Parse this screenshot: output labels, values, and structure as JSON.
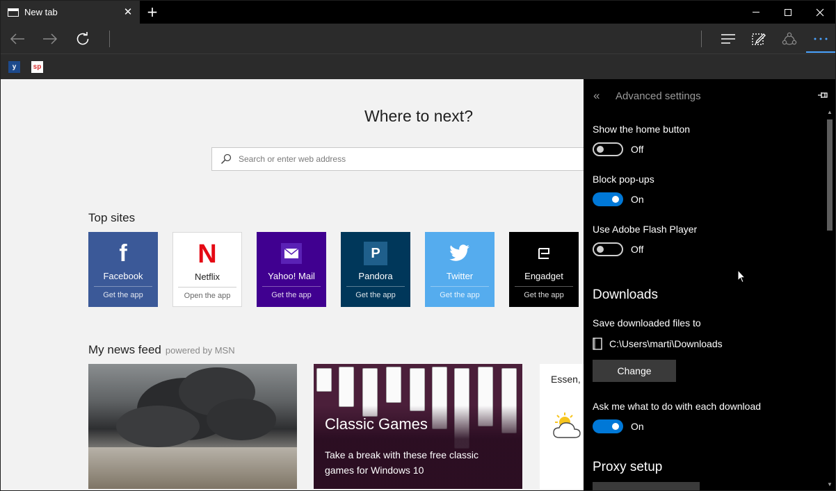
{
  "browser": {
    "tab_title": "New tab",
    "tab_close": "✕",
    "new_tab": "+"
  },
  "favorites": [
    {
      "label": "y"
    },
    {
      "label": "sp"
    }
  ],
  "newtab": {
    "heading": "Where to next?",
    "search_placeholder": "Search or enter web address",
    "top_sites_title": "Top sites",
    "top_sites": [
      {
        "name": "Facebook",
        "action": "Get the app",
        "bg": "#3b5998",
        "fg": "#ffffff"
      },
      {
        "name": "Netflix",
        "action": "Open the app",
        "bg": "#ffffff",
        "fg": "#1f1f1f"
      },
      {
        "name": "Yahoo! Mail",
        "action": "Get the app",
        "bg": "#400090",
        "fg": "#ffffff"
      },
      {
        "name": "Pandora",
        "action": "Get the app",
        "bg": "#00375a",
        "fg": "#ffffff"
      },
      {
        "name": "Twitter",
        "action": "Get the app",
        "bg": "#55acee",
        "fg": "#ffffff"
      },
      {
        "name": "Engadget",
        "action": "Get the app",
        "bg": "#000000",
        "fg": "#ffffff"
      }
    ],
    "news_title": "My news feed",
    "news_powered": "powered by MSN",
    "news": [
      {
        "title": "",
        "text": ""
      },
      {
        "title": "Classic Games",
        "text": "Take a break with these free classic games for Windows 10"
      },
      {
        "title": "Essen, G",
        "text": ""
      }
    ]
  },
  "settings": {
    "back_icon": "«",
    "title": "Advanced settings",
    "show_home_label": "Show the home button",
    "show_home_state": "Off",
    "block_popups_label": "Block pop-ups",
    "block_popups_state": "On",
    "flash_label": "Use Adobe Flash Player",
    "flash_state": "Off",
    "downloads_heading": "Downloads",
    "save_files_label": "Save downloaded files to",
    "download_path": "C:\\Users\\marti\\Downloads",
    "change_button": "Change",
    "ask_download_label": "Ask me what to do with each download",
    "ask_download_state": "On",
    "proxy_heading": "Proxy setup"
  },
  "colors": {
    "accent": "#0078d7",
    "panel_bg": "#000000",
    "chrome_bg": "#2b2b2b"
  }
}
